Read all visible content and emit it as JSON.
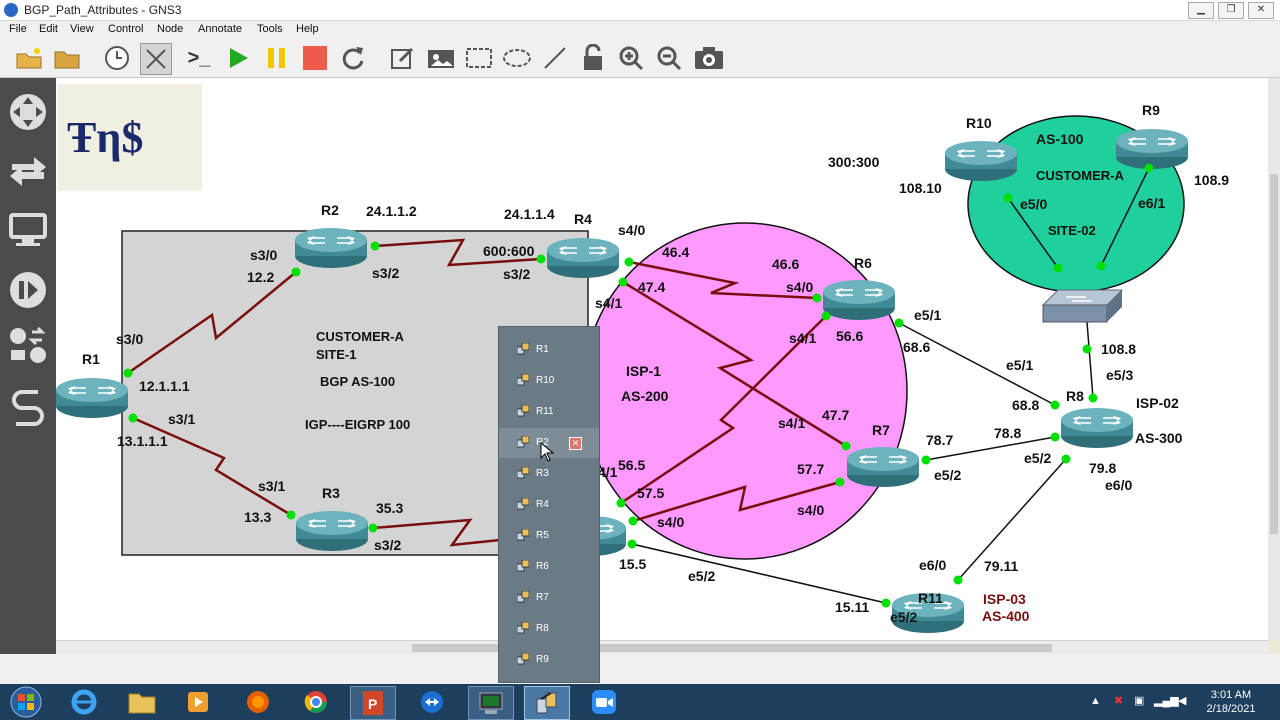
{
  "window": {
    "title": "BGP_Path_Attributes - GNS3"
  },
  "menu": [
    "File",
    "Edit",
    "View",
    "Control",
    "Node",
    "Annotate",
    "Tools",
    "Help"
  ],
  "toolbar": {
    "console_label": ">_"
  },
  "logo_text": "Ŧη$",
  "labels": {
    "r1": "R1",
    "r2": "R2",
    "r3": "R3",
    "r4": "R4",
    "r6": "R6",
    "r7": "R7",
    "r8": "R8",
    "r9": "R9",
    "r10": "R10",
    "r11": "R11",
    "ip_24112": "24.1.1.2",
    "ip_24114": "24.1.1.4",
    "s30_r2": "s3/0",
    "ip_122": "12.2",
    "s32_r2": "s3/2",
    "c600": "600:600",
    "s32_r4": "s3/2",
    "s40_r4": "s4/0",
    "s41_r4": "s4/1",
    "ip_464": "46.4",
    "ip_474": "47.4",
    "cust_a": "CUSTOMER-A",
    "site1": "SITE-1",
    "bgp100": "BGP AS-100",
    "igp": "IGP----EIGRP 100",
    "s30_r1": "s3/0",
    "ip_12111": "12.1.1.1",
    "s31_r1": "s3/1",
    "ip_13111": "13.1.1.1",
    "s31_r3": "s3/1",
    "ip_133": "13.3",
    "ip_353": "35.3",
    "s32_r3": "s3/2",
    "isp1": "ISP-1",
    "as200": "AS-200",
    "ip_466": "46.6",
    "s40_r6": "s4/0",
    "s41_r6": "s4/1",
    "ip_566": "56.6",
    "e51_r6": "e5/1",
    "ip_686": "68.6",
    "ip_477": "47.7",
    "s41_r7": "s4/1",
    "ip_787": "78.7",
    "ip_577": "57.7",
    "e52_r7": "e5/2",
    "s40_r7": "s4/0",
    "s41_r5": "4/1",
    "ip_565": "56.5",
    "ip_575": "57.5",
    "s40_r5": "s4/0",
    "ip_155": "15.5",
    "e52_r5": "e5/2",
    "c300": "300:300",
    "ip_10810": "108.10",
    "ip_1089": "108.9",
    "as100": "AS-100",
    "cust_a2": "CUSTOMER-A",
    "e50_sw": "e5/0",
    "e61_sw": "e6/1",
    "site02": "SITE-02",
    "ip_1088": "108.8",
    "e53_r8": "e5/3",
    "e51_r8": "e5/1",
    "ip_688": "68.8",
    "ip_788": "78.8",
    "isp02": "ISP-02",
    "as300": "AS-300",
    "e52_r8": "e5/2",
    "ip_798": "79.8",
    "e60_r8": "e6/0",
    "e60_r11": "e6/0",
    "ip_7911": "79.11",
    "ip_1511": "15.11",
    "e52_r11": "e5/2",
    "isp03": "ISP-03",
    "as400": "AS-400"
  },
  "popup_items": [
    "R1",
    "R10",
    "R11",
    "R2",
    "R3",
    "R4",
    "R5",
    "R6",
    "R7",
    "R8",
    "R9"
  ],
  "clock": {
    "time": "3:01 AM",
    "date": "2/18/2021"
  },
  "colors": {
    "link": "#7a0d0d",
    "ethernet": "#111111",
    "isp_cloud": "#ff99ff",
    "customer_cloud": "#1fcf9c",
    "router": "#4f9aa6",
    "port_dot": "#00e000"
  }
}
